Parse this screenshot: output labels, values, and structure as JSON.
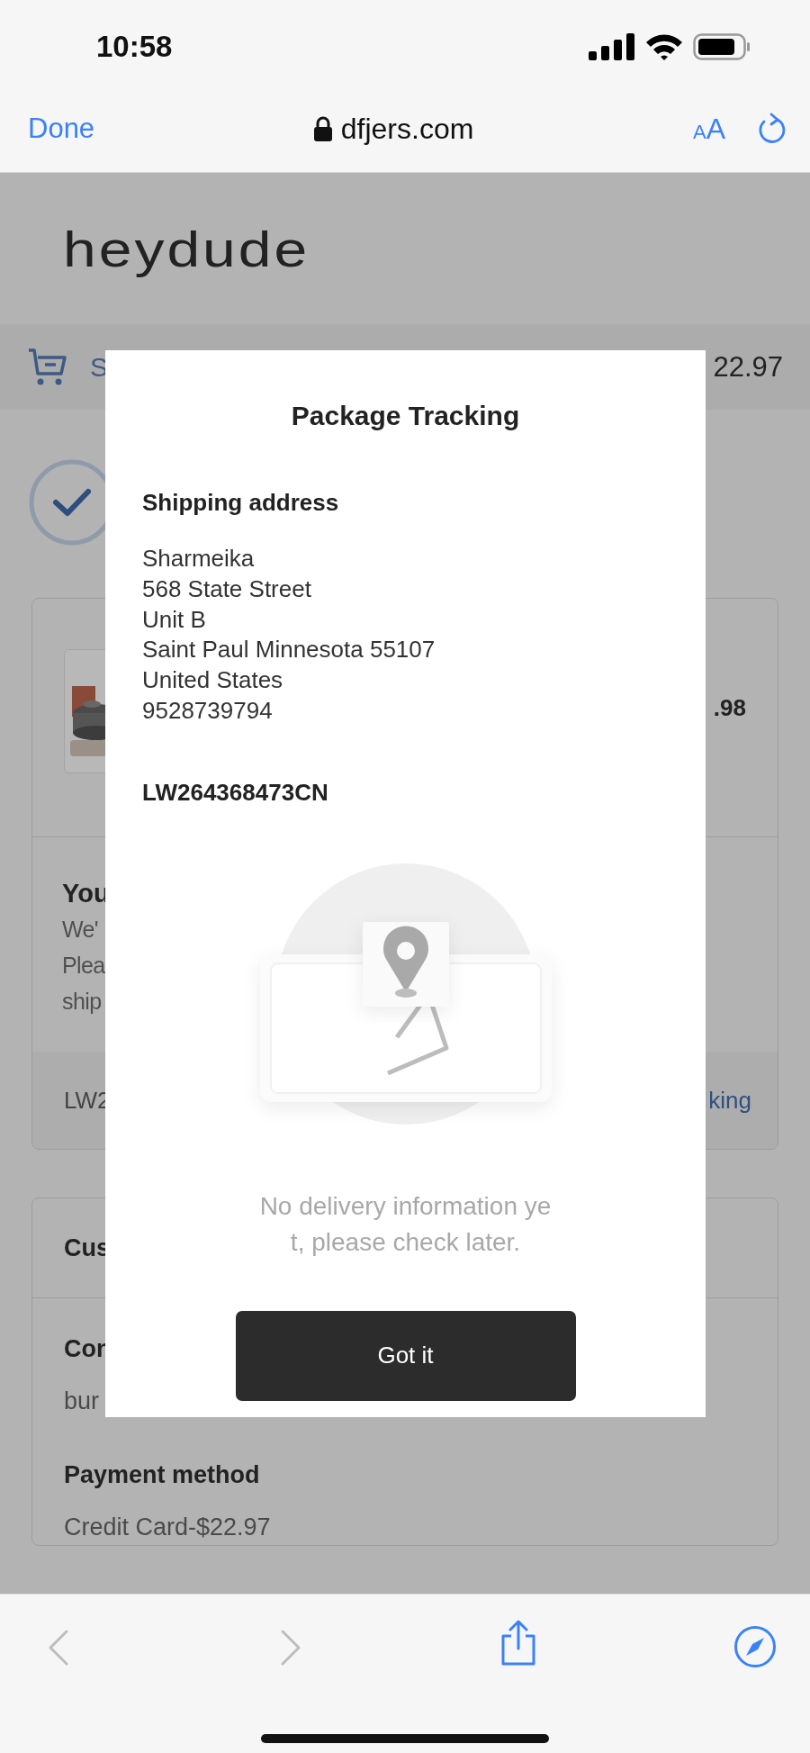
{
  "status_bar": {
    "time": "10:58"
  },
  "browser_bar": {
    "done": "Done",
    "url": "dfjers.com",
    "text_size": "AA"
  },
  "page": {
    "logo": "heydude",
    "cart_bar": {
      "label": "S",
      "total": "22.97"
    },
    "order_card": {
      "price": ".98",
      "heading": "You",
      "lines": [
        "We'",
        "Plea",
        "ship"
      ],
      "tracking_number": "LW2",
      "tracking_link": "king"
    },
    "customer_card": {
      "heading": "Cus",
      "contact_label": "Con",
      "contact_value": "bur",
      "payment_label": "Payment method",
      "payment_value": "Credit Card-$22.97"
    }
  },
  "modal": {
    "title": "Package Tracking",
    "address_heading": "Shipping address",
    "address_lines": [
      "Sharmeika",
      "568 State Street",
      "Unit B",
      "Saint Paul Minnesota 55107",
      "United States",
      "9528739794"
    ],
    "tracking_number": "LW264368473CN",
    "message": "No delivery information yet, please check later.",
    "button": "Got it"
  }
}
